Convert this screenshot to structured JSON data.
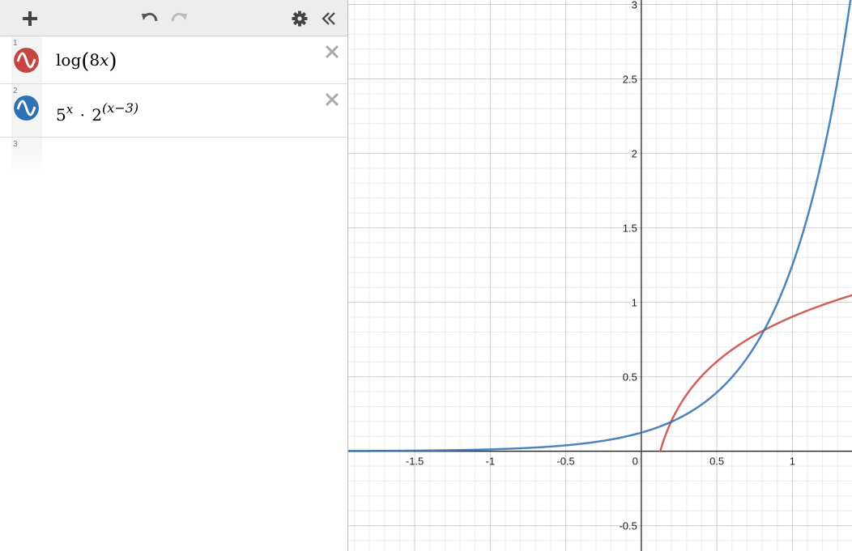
{
  "toolbar": {
    "add_icon": "plus-icon",
    "undo_icon": "undo-icon",
    "redo_icon": "redo-icon",
    "settings_icon": "gear-icon",
    "collapse_icon": "double-chevron-left-icon"
  },
  "expressions": [
    {
      "index": "1",
      "color": "#c74440",
      "latex_parts": [
        "log",
        "(",
        "8",
        "x",
        ")"
      ],
      "text": "log(8x)"
    },
    {
      "index": "2",
      "color": "#2d70b3",
      "base": "5",
      "exp": "x",
      "dot": "·",
      "base2": "2",
      "exp2": "(x−3)",
      "text": "5^x · 2^(x−3)"
    }
  ],
  "empty_row_index": "3",
  "graph": {
    "x_ticks": [
      "-1.5",
      "-1",
      "-0.5",
      "0",
      "0.5",
      "1"
    ],
    "y_ticks": [
      "3",
      "2.5",
      "2",
      "1.5",
      "1",
      "0.5",
      "-0.5"
    ],
    "xlim": [
      -1.94,
      1.4
    ],
    "ylim": [
      -0.67,
      3.03
    ],
    "grid": true
  },
  "chart_data": {
    "type": "line",
    "series": [
      {
        "name": "log(8x)",
        "color": "#c74440",
        "function": "log10(8x)",
        "domain": [
          0.125,
          1.4
        ]
      },
      {
        "name": "5^x · 2^(x−3)",
        "color": "#2d70b3",
        "function": "5^x * 2^(x-3)",
        "domain": [
          -1.94,
          1.4
        ]
      }
    ],
    "xlim": [
      -1.94,
      1.4
    ],
    "ylim": [
      -0.67,
      3.03
    ],
    "x_ticks": [
      -1.5,
      -1,
      -0.5,
      0,
      0.5,
      1
    ],
    "y_ticks": [
      -0.5,
      0.5,
      1,
      1.5,
      2,
      2.5,
      3
    ],
    "grid": true
  }
}
